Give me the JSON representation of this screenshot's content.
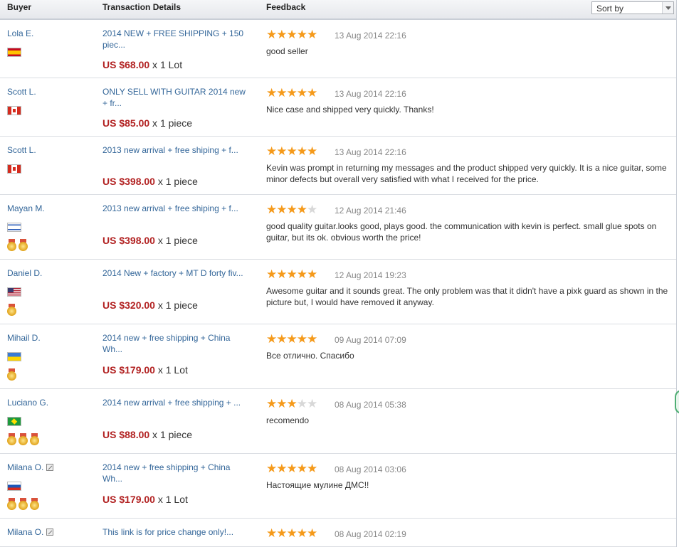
{
  "header": {
    "buyer": "Buyer",
    "details": "Transaction Details",
    "feedback": "Feedback",
    "sort_label": "Sort by"
  },
  "rows": [
    {
      "buyer": "Lola E.",
      "flag": "es",
      "medals": 0,
      "edit": false,
      "product": "2014 NEW + FREE SHIPPING + 150 piec...",
      "price": "US $68.00",
      "qty": " x 1 Lot",
      "rating": 5,
      "date": "13 Aug 2014 22:16",
      "comment": "good seller"
    },
    {
      "buyer": "Scott L.",
      "flag": "ca",
      "medals": 0,
      "edit": false,
      "product": "ONLY SELL WITH GUITAR 2014 new + fr...",
      "price": "US $85.00",
      "qty": " x 1 piece",
      "rating": 5,
      "date": "13 Aug 2014 22:16",
      "comment": "Nice case and shipped very quickly. Thanks!"
    },
    {
      "buyer": "Scott L.",
      "flag": "ca",
      "medals": 0,
      "edit": false,
      "product": "2013 new arrival + free shiping + f...",
      "price": "US $398.00",
      "qty": " x 1 piece",
      "rating": 5,
      "date": "13 Aug 2014 22:16",
      "comment": "Kevin was prompt in returning my messages and the product shipped very quickly. It is a nice guitar, some minor defects but overall very satisfied with what I received for the price."
    },
    {
      "buyer": "Mayan M.",
      "flag": "il",
      "medals": 2,
      "edit": false,
      "product": "2013 new arrival + free shiping + f...",
      "price": "US $398.00",
      "qty": " x 1 piece",
      "rating": 4,
      "date": "12 Aug 2014 21:46",
      "comment": "good quality guitar.looks good, plays good. the communication with kevin is perfect. small glue spots on guitar, but its ok. obvious worth the price!"
    },
    {
      "buyer": "Daniel D.",
      "flag": "us",
      "medals": 1,
      "edit": false,
      "product": "2014 New + factory + MT D forty fiv...",
      "price": "US $320.00",
      "qty": " x 1 piece",
      "rating": 5,
      "date": "12 Aug 2014 19:23",
      "comment": "Awesome guitar and it sounds great. The only problem was that it didn't have a pixk guard as shown in the picture but, I would have removed it anyway."
    },
    {
      "buyer": "Mihail D.",
      "flag": "ua",
      "medals": 1,
      "edit": false,
      "product": "2014 new + free shipping + China Wh...",
      "price": "US $179.00",
      "qty": " x 1 Lot",
      "rating": 5,
      "date": "09 Aug 2014 07:09",
      "comment": "Все отлично. Спасибо"
    },
    {
      "buyer": "Luciano G.",
      "flag": "br",
      "medals": 3,
      "edit": false,
      "product": "2014 new arrival + free shipping + ...",
      "price": "US $88.00",
      "qty": " x 1 piece",
      "rating": 3,
      "date": "08 Aug 2014 05:38",
      "comment": "recomendo"
    },
    {
      "buyer": "Milana O.",
      "flag": "ru",
      "medals": 3,
      "edit": true,
      "product": "2014 new + free shipping + China Wh...",
      "price": "US $179.00",
      "qty": " x 1 Lot",
      "rating": 5,
      "date": "08 Aug 2014 03:06",
      "comment": "Настоящие мулине ДМС!!"
    },
    {
      "buyer": "Milana O.",
      "flag": "",
      "medals": 0,
      "edit": true,
      "product": "This link is for price change only!...",
      "price": "",
      "qty": "",
      "rating": 5,
      "date": "08 Aug 2014 02:19",
      "comment": ""
    }
  ]
}
